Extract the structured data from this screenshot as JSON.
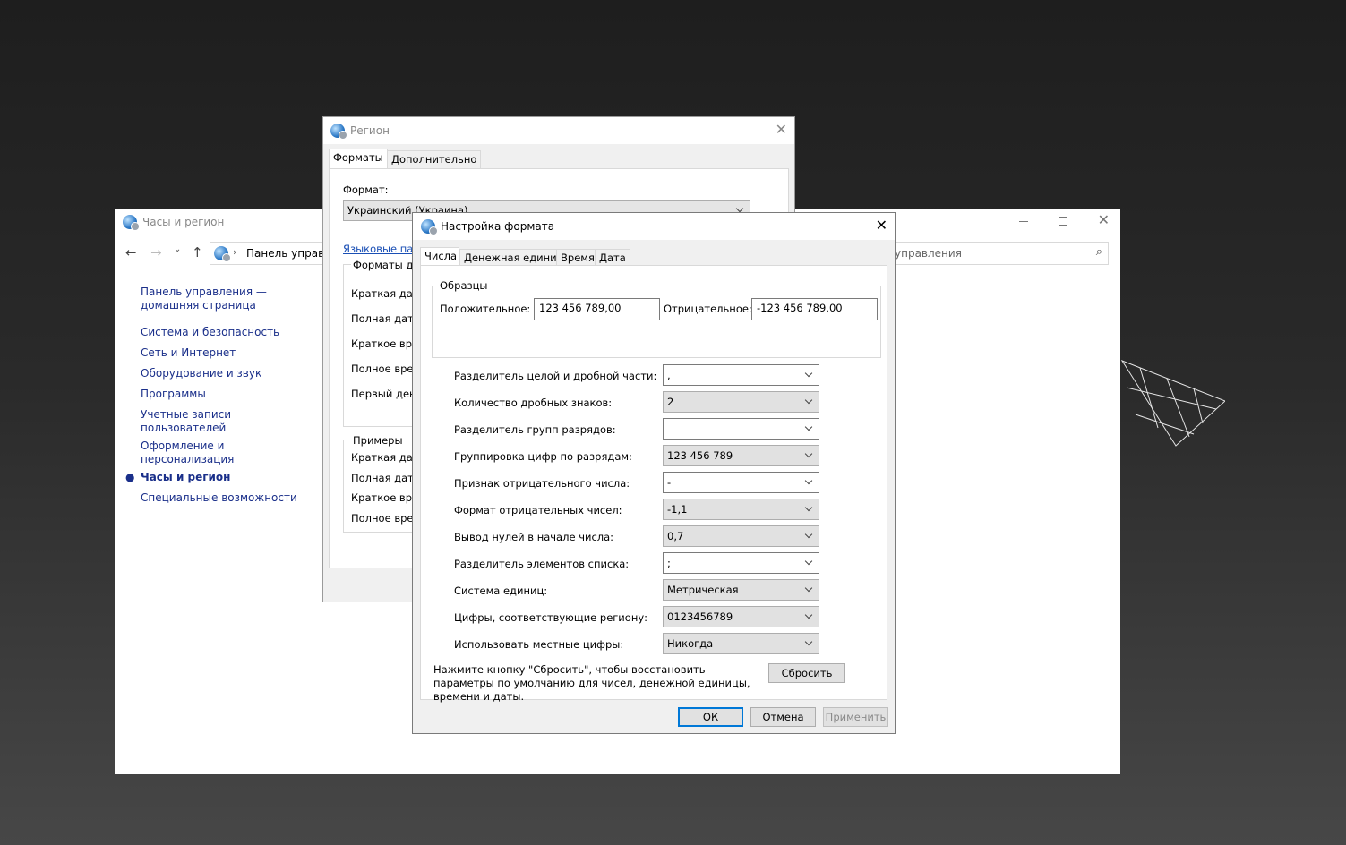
{
  "control_panel": {
    "title": "Часы и регион",
    "address": "Панель управле",
    "search_placeholder": "управления",
    "sidebar": [
      {
        "label": "Панель управления —\nдомашняя страница",
        "current": false
      },
      {
        "label": "Система и безопасность",
        "current": false
      },
      {
        "label": "Сеть и Интернет",
        "current": false
      },
      {
        "label": "Оборудование и звук",
        "current": false
      },
      {
        "label": "Программы",
        "current": false
      },
      {
        "label": "Учетные записи\nпользователей",
        "current": false
      },
      {
        "label": "Оформление и\nперсонализация",
        "current": false
      },
      {
        "label": "Часы и регион",
        "current": true
      },
      {
        "label": "Специальные возможности",
        "current": false
      }
    ]
  },
  "region": {
    "title": "Регион",
    "tabs": [
      "Форматы",
      "Дополнительно"
    ],
    "format_label": "Формат:",
    "format_value": "Украинский (Украина)",
    "lang_link": "Языковые пар",
    "group1_title": "Форматы дат",
    "group1_rows": [
      "Краткая дата",
      "Полная дата",
      "Краткое врем",
      "Полное врем",
      "Первый день"
    ],
    "group2_title": "Примеры",
    "group2_rows": [
      "Краткая дата",
      "Полная дата:",
      "Краткое врем",
      "Полное врем"
    ]
  },
  "format_dialog": {
    "title": "Настройка формата",
    "tabs": [
      "Числа",
      "Денежная единица",
      "Время",
      "Дата"
    ],
    "samples_title": "Образцы",
    "positive_label": "Положительное:",
    "positive_value": "123 456 789,00",
    "negative_label": "Отрицательное:",
    "negative_value": "-123 456 789,00",
    "settings": [
      {
        "label": "Разделитель целой и дробной части:",
        "value": ",",
        "editable": true
      },
      {
        "label": "Количество дробных знаков:",
        "value": "2",
        "editable": false
      },
      {
        "label": "Разделитель групп разрядов:",
        "value": "",
        "editable": true
      },
      {
        "label": "Группировка цифр по разрядам:",
        "value": "123 456 789",
        "editable": false
      },
      {
        "label": "Признак отрицательного числа:",
        "value": "-",
        "editable": true
      },
      {
        "label": "Формат отрицательных чисел:",
        "value": "-1,1",
        "editable": false
      },
      {
        "label": "Вывод нулей в начале числа:",
        "value": "0,7",
        "editable": false
      },
      {
        "label": "Разделитель элементов списка:",
        "value": ";",
        "editable": true
      },
      {
        "label": "Система единиц:",
        "value": "Метрическая",
        "editable": false
      },
      {
        "label": "Цифры, соответствующие региону:",
        "value": "0123456789",
        "editable": false
      },
      {
        "label": "Использовать местные цифры:",
        "value": "Никогда",
        "editable": false
      }
    ],
    "reset_note": "Нажмите кнопку \"Сбросить\", чтобы восстановить параметры по умолчанию для чисел, денежной единицы, времени и даты.",
    "reset_button": "Сбросить",
    "ok": "ОК",
    "cancel": "Отмена",
    "apply": "Применить"
  }
}
